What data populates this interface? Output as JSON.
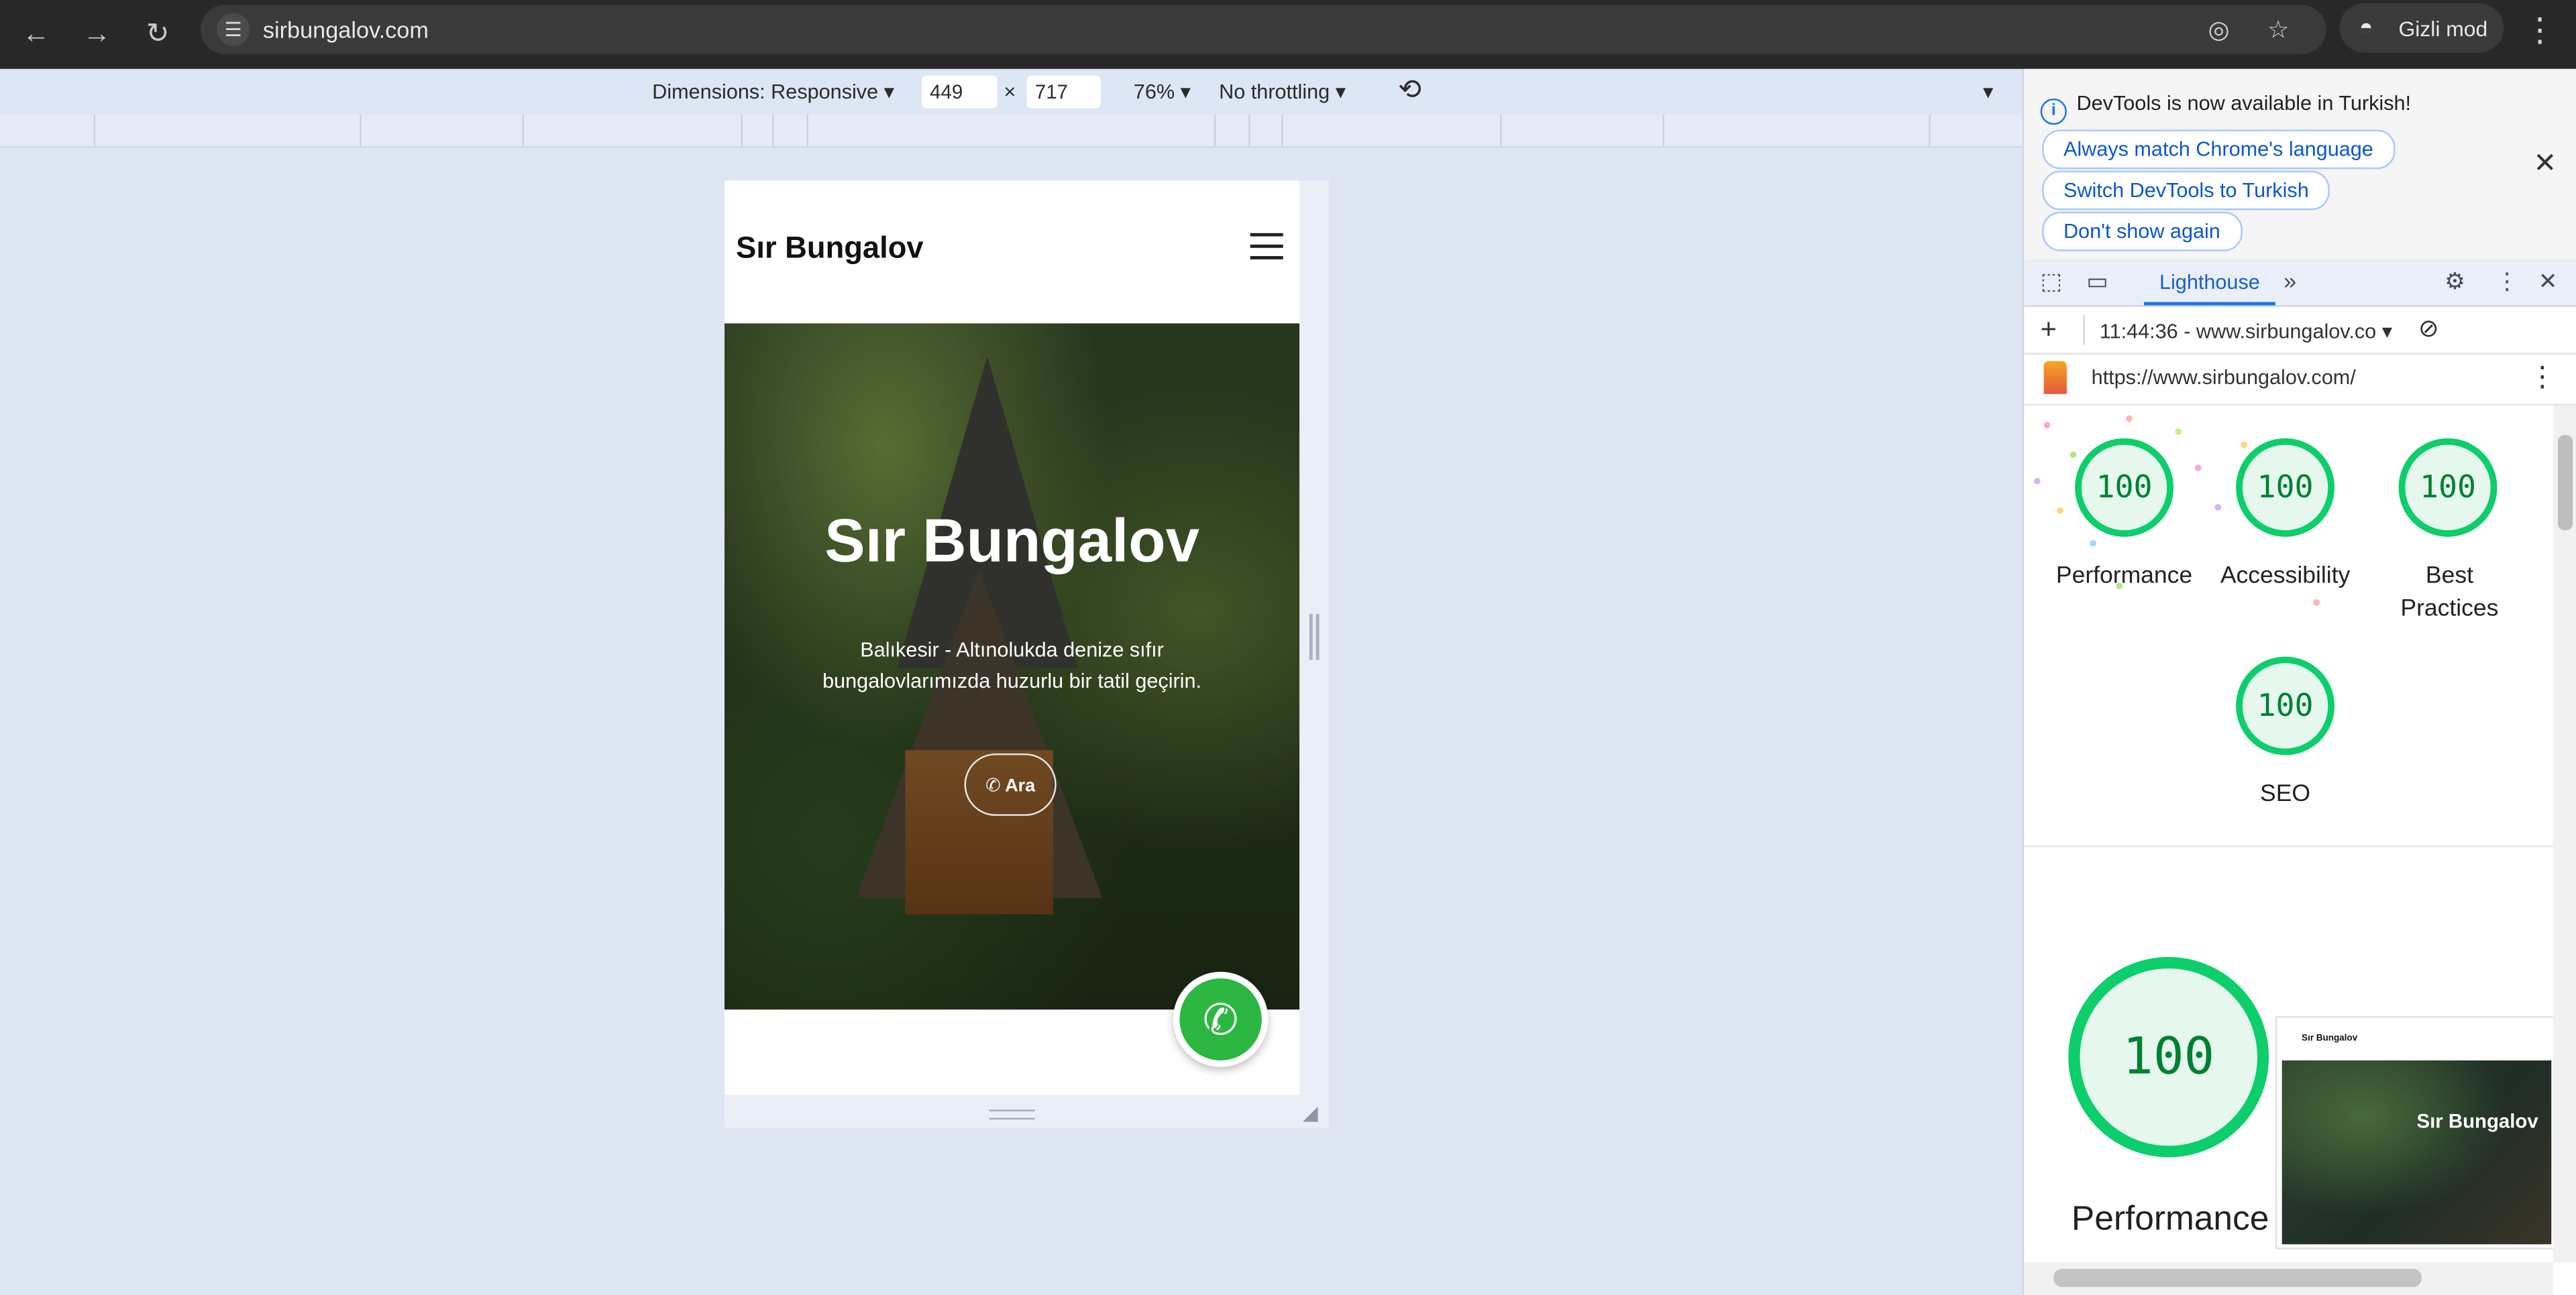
{
  "browser": {
    "url": "sirbungalov.com",
    "incognito_label": "Gizli mod"
  },
  "device_toolbar": {
    "dimensions_label": "Dimensions: Responsive",
    "width": "449",
    "times": "×",
    "height": "717",
    "zoom": "76%",
    "throttling": "No throttling"
  },
  "site": {
    "logo": "Sır Bungalov",
    "hero_title": "Sır Bungalov",
    "hero_subtitle": "Balıkesir - Altınolukda denize sıfır bungalovlarımızda huzurlu bir tatil geçirin.",
    "call_button": "Ara"
  },
  "devtools": {
    "banner_message": "DevTools is now available in Turkish!",
    "banner_buttons": [
      "Always match Chrome's language",
      "Switch DevTools to Turkish",
      "Don't show again"
    ],
    "active_tab": "Lighthouse",
    "report_selector": "11:44:36 - www.sirbungalov.co",
    "report_url": "https://www.sirbungalov.com/",
    "scores": [
      {
        "label": "Performance",
        "value": "100"
      },
      {
        "label": "Accessibility",
        "value": "100"
      },
      {
        "label": "Best Practices",
        "value": "100"
      },
      {
        "label": "SEO",
        "value": "100"
      }
    ],
    "main_score": {
      "label": "Performance",
      "value": "100"
    },
    "thumbnail": {
      "logo": "Sır Bungalov",
      "title": "Sır Bungalov"
    },
    "accent_color": "#0cce6b"
  }
}
